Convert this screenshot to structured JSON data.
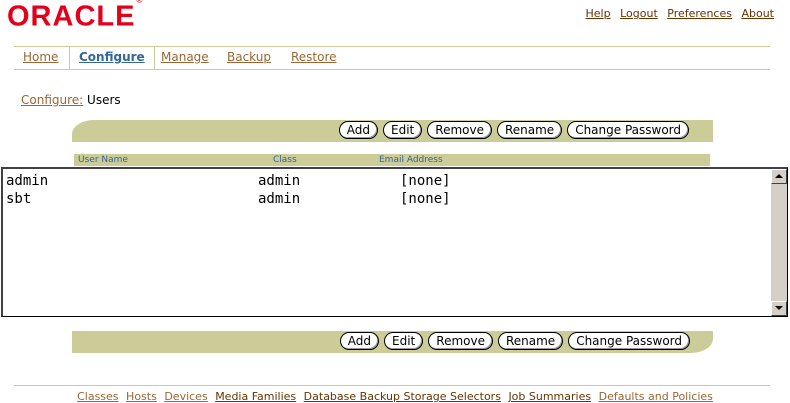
{
  "brand": {
    "logo_text": "ORACLE",
    "trademark": "®",
    "color": "#e4001b"
  },
  "global_links": [
    "Help",
    "Logout",
    "Preferences",
    "About"
  ],
  "tabs": [
    {
      "label": "Home",
      "active": false
    },
    {
      "label": "Configure",
      "active": true
    },
    {
      "label": "Manage",
      "active": false
    },
    {
      "label": "Backup",
      "active": false
    },
    {
      "label": "Restore",
      "active": false
    }
  ],
  "breadcrumb": {
    "parent": "Configure:",
    "current": "Users"
  },
  "actions": {
    "add": "Add",
    "edit": "Edit",
    "remove": "Remove",
    "rename": "Rename",
    "change_password": "Change Password"
  },
  "table": {
    "columns": [
      "User Name",
      "Class",
      "Email Address"
    ],
    "rows": [
      {
        "user": "admin",
        "class": "admin",
        "email": "[none]"
      },
      {
        "user": "sbt",
        "class": "admin",
        "email": "[none]"
      }
    ]
  },
  "footer_links": [
    "Classes",
    "Hosts",
    "Devices",
    "Media Families",
    "Database Backup Storage Selectors",
    "Job Summaries",
    "Defaults and Policies"
  ],
  "colors": {
    "accent_tan": "#cccc99",
    "link_brown": "#996633",
    "active_tab_blue": "#336699"
  }
}
